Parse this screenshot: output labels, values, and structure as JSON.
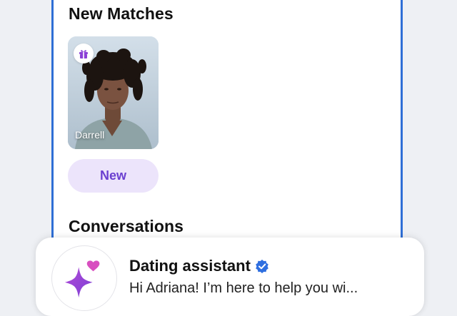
{
  "new_matches": {
    "title": "New Matches",
    "cards": [
      {
        "name": "Darrell",
        "badge_icon": "gift-icon",
        "status_label": "New"
      }
    ]
  },
  "conversations": {
    "title": "Conversations",
    "items": [
      {
        "name": "Dating assistant",
        "verified_icon": "verified-badge-icon",
        "avatar_icon": "sparkle-heart-icon",
        "preview": "Hi Adriana! I’m here to help you wi..."
      }
    ]
  },
  "colors": {
    "accent_border": "#2f6fd6",
    "pill_background": "#ece4fb",
    "pill_text": "#6a3fd0",
    "assistant_icon": "#9b3fd9"
  }
}
